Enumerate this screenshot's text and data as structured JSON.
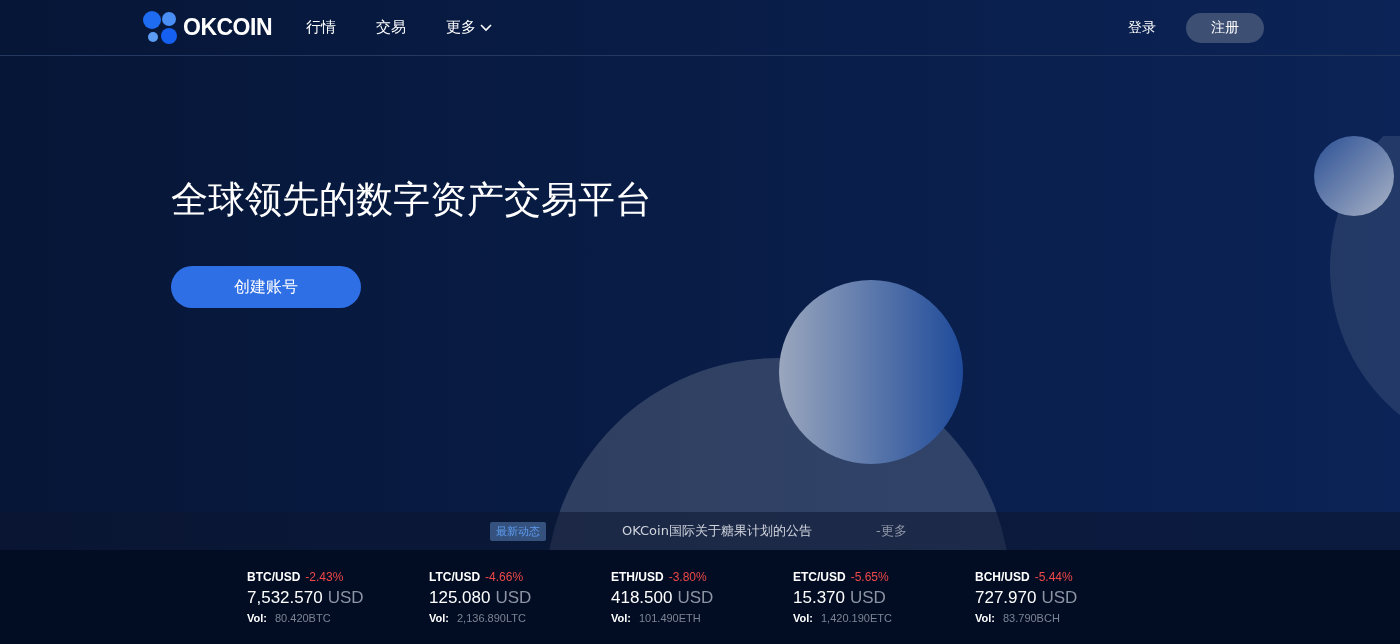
{
  "header": {
    "logo": "OKCOIN",
    "nav": [
      {
        "label": "行情",
        "dropdown": false
      },
      {
        "label": "交易",
        "dropdown": false
      },
      {
        "label": "更多",
        "dropdown": true
      }
    ],
    "login": "登录",
    "register": "注册"
  },
  "hero": {
    "title": "全球领先的数字资产交易平台",
    "cta": "创建账号"
  },
  "notice": {
    "badge": "最新动态",
    "text": "OKCoin国际关于糖果计划的公告",
    "more": "-更多"
  },
  "tickers": [
    {
      "pair": "BTC/USD",
      "change": "-2.43%",
      "price": "7,532.570",
      "unit": "USD",
      "vol_label": "Vol:",
      "vol": "80.420BTC"
    },
    {
      "pair": "LTC/USD",
      "change": "-4.66%",
      "price": "125.080",
      "unit": "USD",
      "vol_label": "Vol:",
      "vol": "2,136.890LTC"
    },
    {
      "pair": "ETH/USD",
      "change": "-3.80%",
      "price": "418.500",
      "unit": "USD",
      "vol_label": "Vol:",
      "vol": "101.490ETH"
    },
    {
      "pair": "ETC/USD",
      "change": "-5.65%",
      "price": "15.370",
      "unit": "USD",
      "vol_label": "Vol:",
      "vol": "1,420.190ETC"
    },
    {
      "pair": "BCH/USD",
      "change": "-5.44%",
      "price": "727.970",
      "unit": "USD",
      "vol_label": "Vol:",
      "vol": "83.790BCH"
    }
  ]
}
